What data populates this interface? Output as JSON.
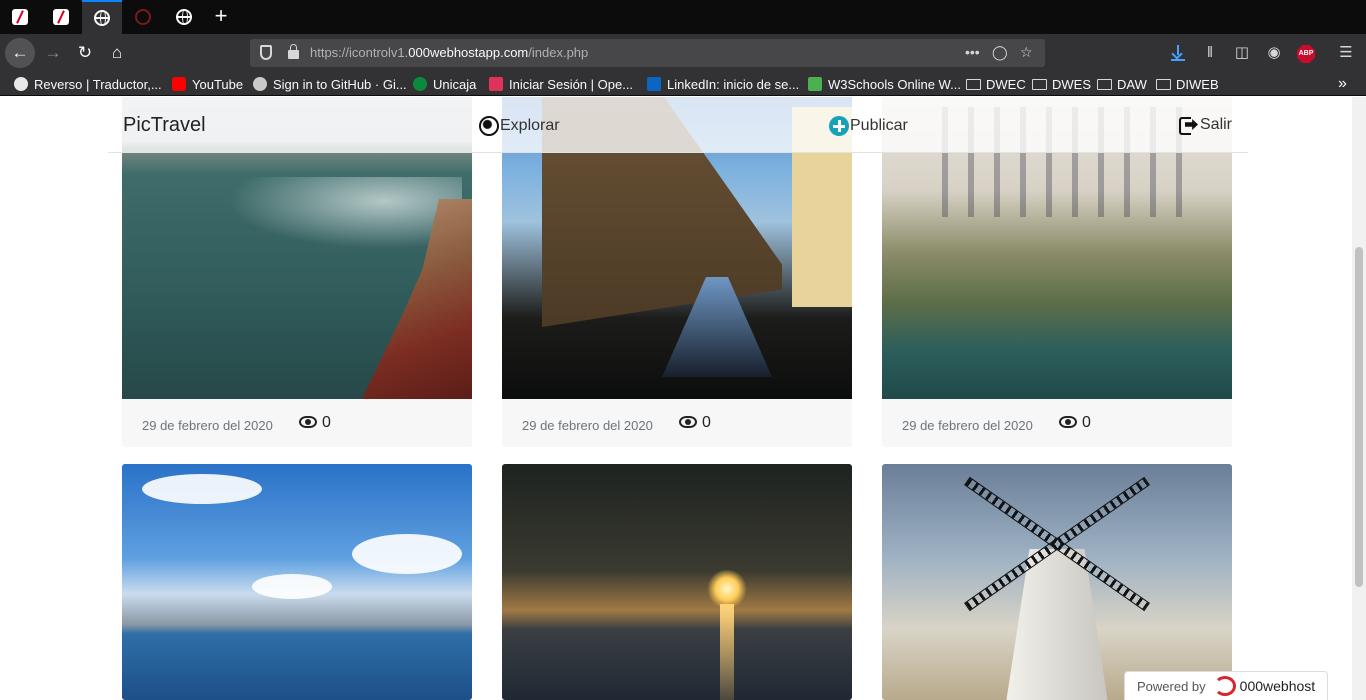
{
  "browser": {
    "new_tab": "+",
    "back_icon": "arrow-left-icon",
    "url_prefix": "https://icontrolv1.",
    "url_host": "000webhostapp.com",
    "url_path": "/index.php",
    "page_actions": "•••",
    "bookmarks": [
      {
        "label": "Reverso | Traductor,...",
        "icon_color": "#e8e8e8"
      },
      {
        "label": "YouTube",
        "icon_color": "#ff0000"
      },
      {
        "label": "Sign in to GitHub · Gi...",
        "icon_color": "#c9c9c9"
      },
      {
        "label": "Unicaja",
        "icon_color": "#0a8a3a"
      },
      {
        "label": "Iniciar Sesión | Ope...",
        "icon_color": "#e0325a"
      },
      {
        "label": "LinkedIn: inicio de se...",
        "icon_color": "#0a66c2"
      },
      {
        "label": "W3Schools Online W...",
        "icon_color": "#4caf50"
      }
    ],
    "folders": [
      "DWEC",
      "DWES",
      "DAW",
      "DIWEB"
    ],
    "overflow_label": "»"
  },
  "site": {
    "brand": "PicTravel",
    "nav": {
      "explore": "Explorar",
      "publish": "Publicar",
      "logout": "Salir"
    },
    "accent_color": "#17a2b8"
  },
  "posts": [
    {
      "date": "29 de febrero del 2020",
      "views": "0",
      "scene": "coastal cliffs"
    },
    {
      "date": "29 de febrero del 2020",
      "views": "0",
      "scene": "castle wall moat"
    },
    {
      "date": "29 de febrero del 2020",
      "views": "0",
      "scene": "hanging houses"
    },
    {
      "scene": "bay with clouds"
    },
    {
      "scene": "sunset over sea"
    },
    {
      "scene": "windmill"
    }
  ],
  "footer_badge": {
    "label": "Powered by",
    "name": "000webhost"
  }
}
